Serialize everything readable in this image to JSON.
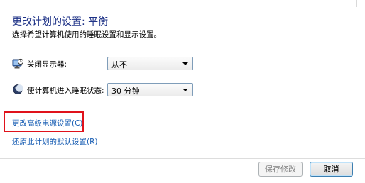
{
  "header": {
    "title": "更改计划的设置: 平衡",
    "subtitle": "选择希望计算机使用的睡眠设置和显示设置。"
  },
  "settings": {
    "display_off": {
      "label": "关闭显示器:",
      "value": "从不",
      "icon": "monitor-clock-icon"
    },
    "sleep": {
      "label": "使计算机进入睡眠状态:",
      "value": "30 分钟",
      "icon": "moon-sleep-icon"
    }
  },
  "links": {
    "advanced": "更改高级电源设置(C)",
    "restore_defaults": "还原此计划的默认设置(R)"
  },
  "buttons": {
    "save": "保存修改",
    "cancel": "取消"
  },
  "colors": {
    "title": "#1e3287",
    "link": "#1a5fb4",
    "highlight": "#e0121b"
  }
}
